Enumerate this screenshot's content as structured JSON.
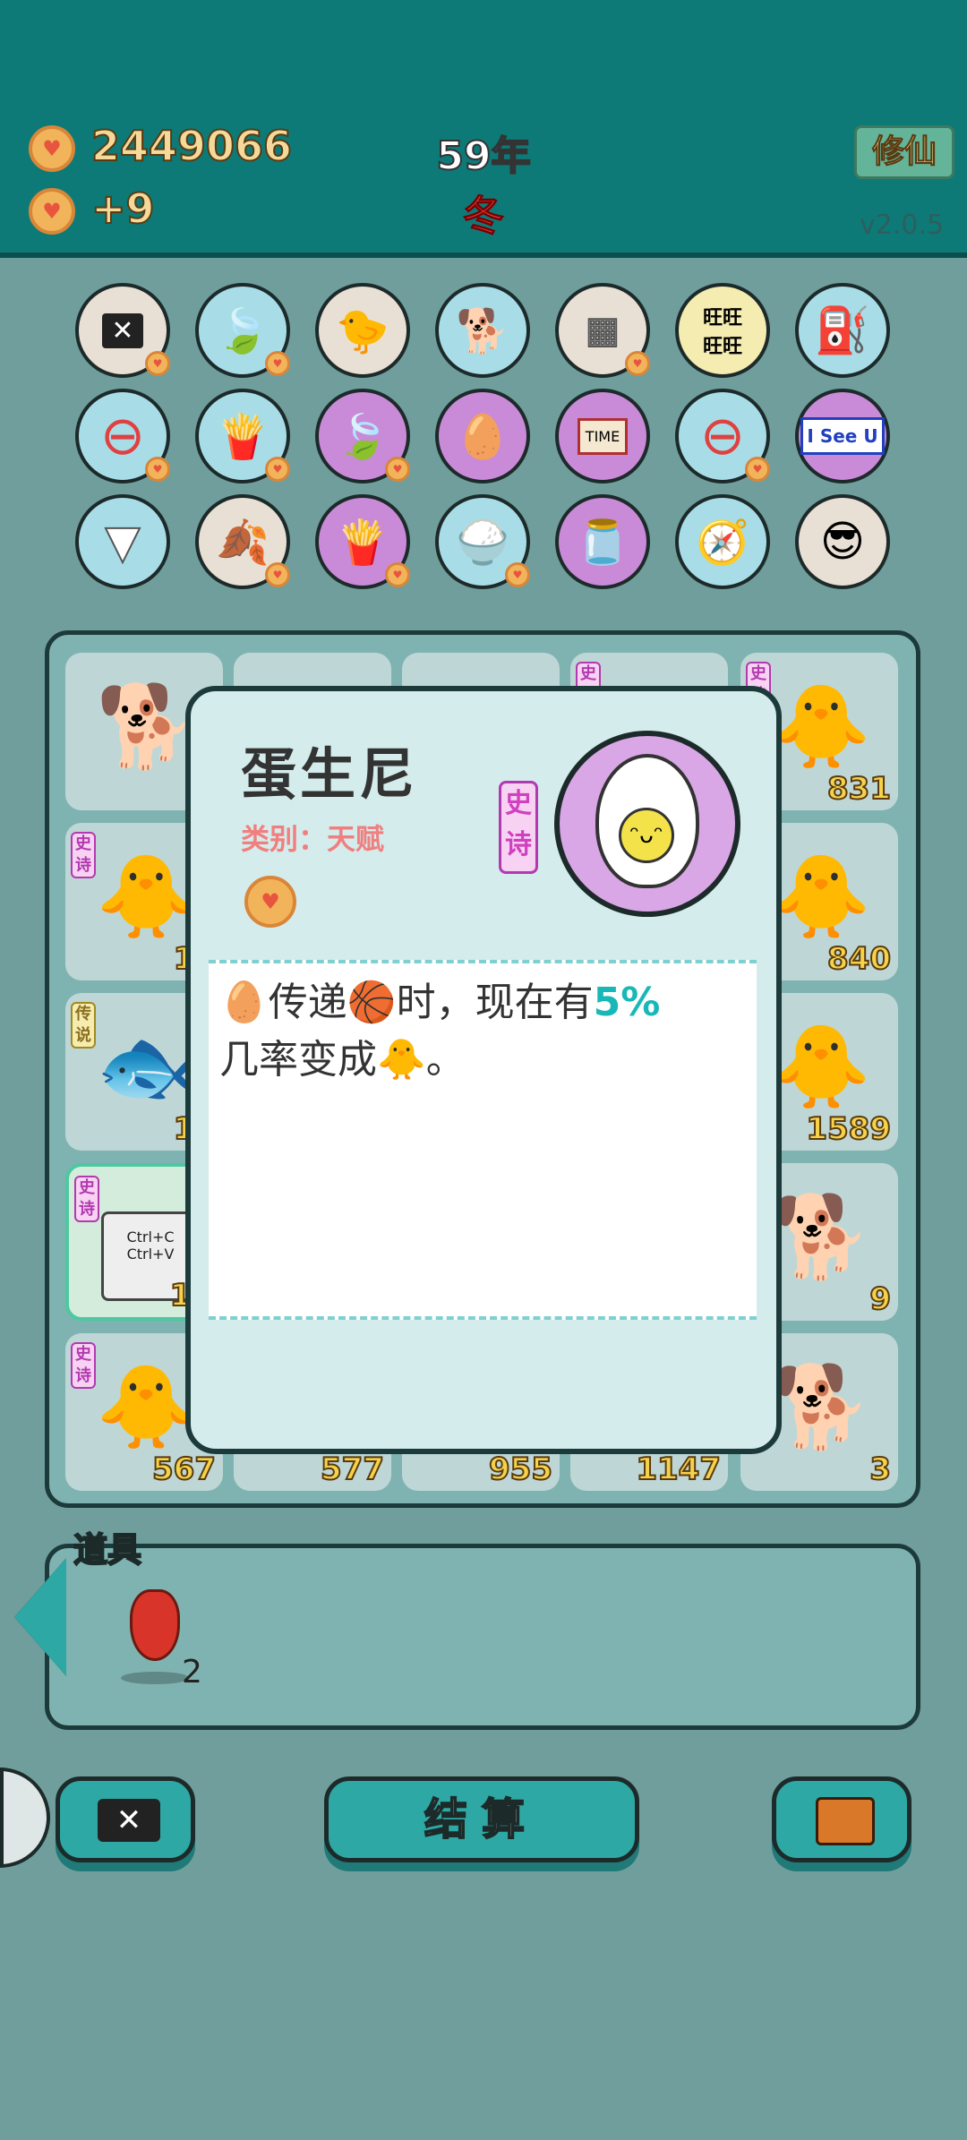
{
  "header": {
    "coins": "2449066",
    "coins_gain": "+9",
    "year": "59年",
    "season": "冬",
    "cultivate_button": "修仙",
    "version": "v2.0.5"
  },
  "inventory_icons": [
    [
      "close-card",
      "leaf",
      "chick-egg",
      "husky",
      "sugar-cubes",
      "wang-tiles",
      "pump"
    ],
    [
      "ban",
      "fries",
      "leaf",
      "egg-sunny",
      "time-magazine",
      "ban",
      "isee-u"
    ],
    [
      "skirt",
      "leaf",
      "fries",
      "rice-bowl",
      "milk-jar",
      "compass",
      "sunglasses-cat"
    ]
  ],
  "isee_label": "I See U",
  "board_numbers": {
    "r1c5": "831",
    "r2c1": "10",
    "r2c5": "840",
    "r3c1": "11",
    "r3c5": "1589",
    "r4c1": "11",
    "r4c5": "9",
    "r5c1": "567",
    "r5c2": "577",
    "r5c3": "955",
    "r5c4": "1147",
    "r5c5": "3"
  },
  "board_tags": {
    "epic": "史诗",
    "legend": "传说"
  },
  "copy_paste_keys": [
    "Ctrl+C",
    "Ctrl+V"
  ],
  "modal": {
    "title": "蛋生尼",
    "category": "类别：天赋",
    "rarity": "史诗",
    "desc_part1": "传递",
    "desc_part2": "时，现在有",
    "desc_percent": "5%",
    "desc_part3": "几率变成",
    "desc_part4": "。"
  },
  "items": {
    "label": "道具",
    "pepper_count": "2"
  },
  "bottom": {
    "settle_button": "结算"
  },
  "colors": {
    "header_bg": "#0d7a78",
    "accent": "#2ea8a4",
    "highlight": "#19b8b8",
    "gold": "#f4d24a"
  }
}
